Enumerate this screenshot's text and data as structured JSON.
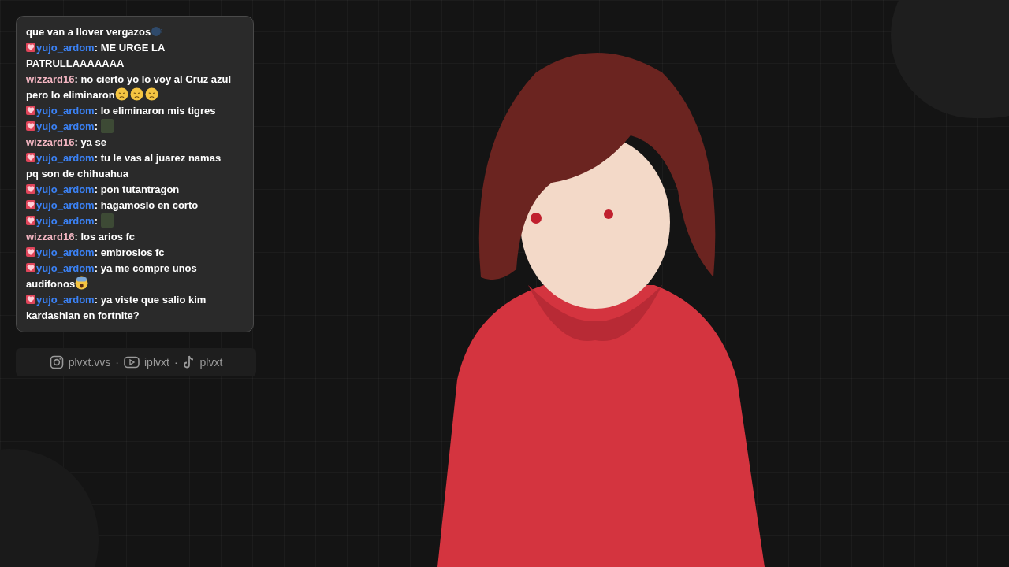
{
  "chat": {
    "colon": ":",
    "messages": [
      {
        "badge": false,
        "text": "que van a llover vergazos",
        "emotes": [
          {
            "kind": "speaking-head"
          }
        ]
      },
      {
        "user": "yujo_ardom",
        "badge": true,
        "color": "#3b82f6",
        "text": "ME URGE LA PATRULLAAAAAAA"
      },
      {
        "user": "wizzard16",
        "badge": false,
        "color": "#f4b6c2",
        "text": "no cierto yo lo voy al Cruz azul pero lo eliminaron",
        "emotes": [
          {
            "kind": "sad-face"
          },
          {
            "kind": "sad-face"
          },
          {
            "kind": "sad-face"
          }
        ]
      },
      {
        "user": "yujo_ardom",
        "badge": true,
        "color": "#3b82f6",
        "text": "lo eliminaron mis tigres"
      },
      {
        "user": "yujo_ardom",
        "badge": true,
        "color": "#3b82f6",
        "emotes": [
          {
            "kind": "image"
          }
        ]
      },
      {
        "user": "wizzard16",
        "badge": false,
        "color": "#f4b6c2",
        "text": "ya se"
      },
      {
        "user": "yujo_ardom",
        "badge": true,
        "color": "#3b82f6",
        "text": "tu le vas al juarez namas pq son de chihuahua"
      },
      {
        "user": "yujo_ardom",
        "badge": true,
        "color": "#3b82f6",
        "text": "pon tutantragon"
      },
      {
        "user": "yujo_ardom",
        "badge": true,
        "color": "#3b82f6",
        "text": "hagamoslo en corto"
      },
      {
        "user": "yujo_ardom",
        "badge": true,
        "color": "#3b82f6",
        "emotes": [
          {
            "kind": "image"
          }
        ]
      },
      {
        "user": "wizzard16",
        "badge": false,
        "color": "#f4b6c2",
        "text": "los arios fc"
      },
      {
        "user": "yujo_ardom",
        "badge": true,
        "color": "#3b82f6",
        "text": "embrosios fc"
      },
      {
        "user": "yujo_ardom",
        "badge": true,
        "color": "#3b82f6",
        "text": "ya me compre unos audifonos",
        "emotes": [
          {
            "kind": "scream-face"
          }
        ]
      },
      {
        "user": "yujo_ardom",
        "badge": true,
        "color": "#3b82f6",
        "text": "ya viste que salio kim kardashian en fortnite?"
      }
    ]
  },
  "socials": [
    {
      "kind": "instagram",
      "handle": "plvxt.vvs"
    },
    {
      "kind": "youtube",
      "handle": "iplvxt"
    },
    {
      "kind": "tiktok",
      "handle": "plvxt"
    }
  ],
  "separator": "·"
}
